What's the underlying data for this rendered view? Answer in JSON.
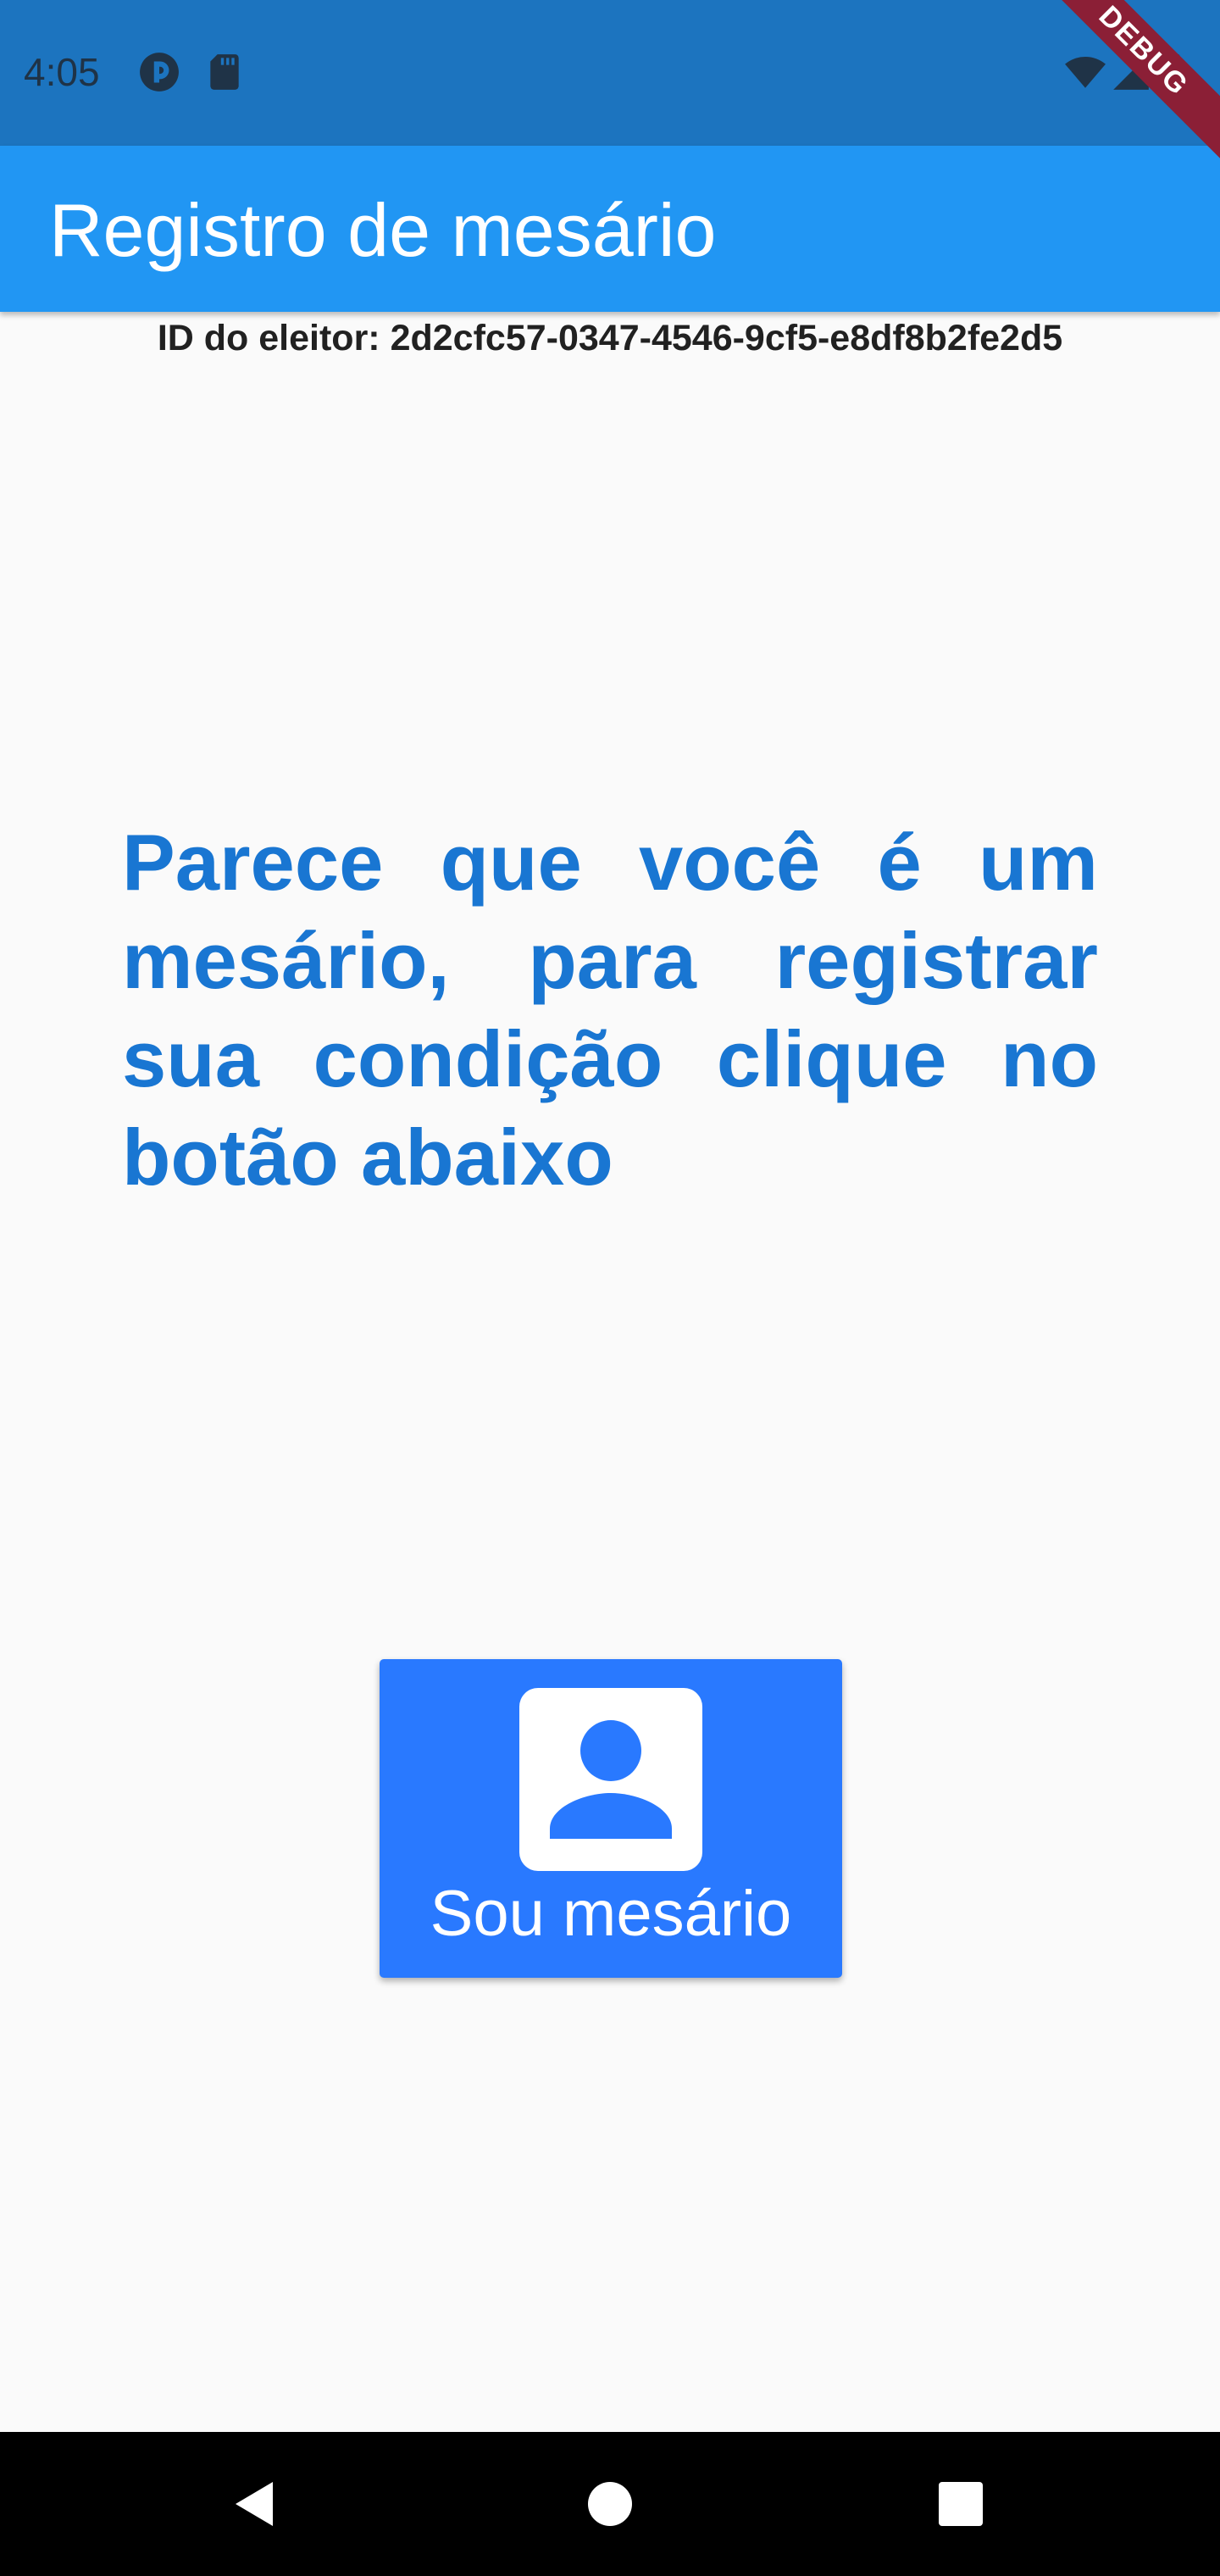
{
  "status_bar": {
    "time": "4:05",
    "left_icons": [
      "app-notification-icon",
      "sd-card-icon"
    ],
    "right_icons": [
      "wifi-icon",
      "signal-icon",
      "battery-icon"
    ]
  },
  "debug_banner": {
    "label": "DEBUG"
  },
  "app_bar": {
    "title": "Registro de mesário"
  },
  "content": {
    "voter_id": "ID do eleitor: 2d2cfc57-0347-4546-9cf5-e8df8b2fe2d5",
    "message": "Parece que você é um mesário, para registrar sua condição clique no botão abaixo"
  },
  "button": {
    "icon": "person-icon",
    "label": "Sou mesário"
  },
  "nav_bar": {
    "buttons": [
      "back-icon",
      "home-icon",
      "recents-icon"
    ]
  },
  "colors": {
    "status_bar": "#1c74bf",
    "app_bar": "#2196f3",
    "message_text": "#1976d2",
    "button": "#2979ff",
    "debug_banner": "#8b1f36"
  }
}
